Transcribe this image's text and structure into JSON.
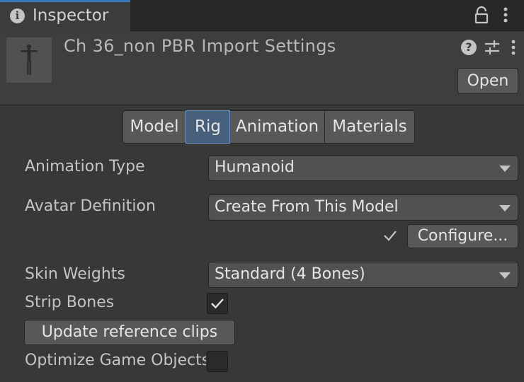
{
  "window": {
    "tab_title": "Inspector",
    "tab_icon": "info-icon",
    "lock_icon": "lock-icon",
    "menu_icon": "kebab-menu-icon"
  },
  "header": {
    "title": "Ch 36_non PBR Import Settings",
    "thumbnail": "humanoid-model-thumbnail",
    "help_icon_glyph": "?",
    "open_label": "Open"
  },
  "tabs": [
    {
      "label": "Model",
      "active": false
    },
    {
      "label": "Rig",
      "active": true
    },
    {
      "label": "Animation",
      "active": false
    },
    {
      "label": "Materials",
      "active": false
    }
  ],
  "rig": {
    "animation_type": {
      "label": "Animation Type",
      "value": "Humanoid"
    },
    "avatar_definition": {
      "label": "Avatar Definition",
      "value": "Create From This Model"
    },
    "configure_label": "Configure...",
    "skin_weights": {
      "label": "Skin Weights",
      "value": "Standard (4 Bones)"
    },
    "strip_bones": {
      "label": "Strip Bones",
      "checked": true
    },
    "update_clips_label": "Update reference clips",
    "optimize_game_objects": {
      "label": "Optimize Game Objects",
      "checked": false
    }
  },
  "colors": {
    "background": "#383838",
    "tab_accent": "#3a79bb",
    "active_tab": "#46607c"
  }
}
